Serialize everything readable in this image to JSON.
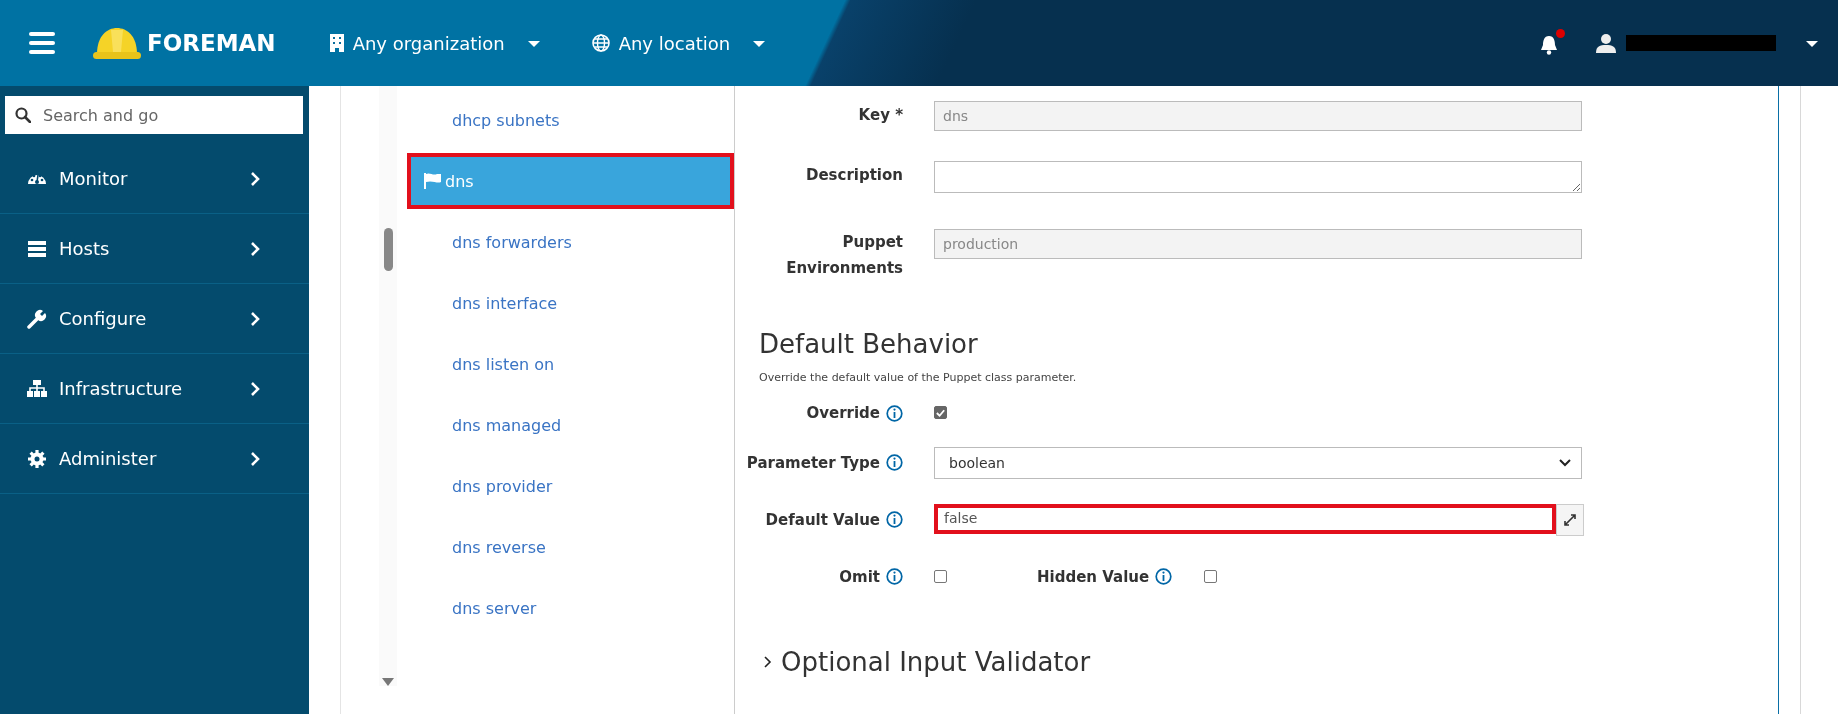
{
  "header": {
    "brand": "FOREMAN",
    "organization": "Any organization",
    "location": "Any location",
    "notifications": {
      "unread": true
    }
  },
  "sidebar": {
    "search": {
      "placeholder": "Search and go"
    },
    "items": [
      {
        "label": "Monitor"
      },
      {
        "label": "Hosts"
      },
      {
        "label": "Configure"
      },
      {
        "label": "Infrastructure"
      },
      {
        "label": "Administer"
      }
    ]
  },
  "parameter_list": {
    "items": [
      {
        "label": "dhcp subnets",
        "selected": false,
        "highlighted": false
      },
      {
        "label": "dns",
        "selected": true,
        "highlighted": true
      },
      {
        "label": "dns forwarders",
        "selected": false,
        "highlighted": false
      },
      {
        "label": "dns interface",
        "selected": false,
        "highlighted": false
      },
      {
        "label": "dns listen on",
        "selected": false,
        "highlighted": false
      },
      {
        "label": "dns managed",
        "selected": false,
        "highlighted": false
      },
      {
        "label": "dns provider",
        "selected": false,
        "highlighted": false
      },
      {
        "label": "dns reverse",
        "selected": false,
        "highlighted": false
      },
      {
        "label": "dns server",
        "selected": false,
        "highlighted": false
      }
    ]
  },
  "form": {
    "fields": [
      {
        "kind": "text",
        "label": "Key *",
        "value": "dns",
        "disabled": true
      },
      {
        "kind": "textarea",
        "label": "Description",
        "disabled": false
      },
      {
        "kind": "text",
        "label": "Puppet Environments",
        "value": "production",
        "disabled": true
      }
    ],
    "default_behavior": {
      "title": "Default Behavior",
      "description": "Override the default value of the Puppet class parameter.",
      "rows": [
        {
          "kind": "checkbox",
          "label": "Override",
          "checked": true
        },
        {
          "kind": "select",
          "label": "Parameter Type",
          "value": "boolean"
        },
        {
          "kind": "expandable",
          "label": "Default Value",
          "value": "false",
          "highlighted": true
        },
        {
          "kind": "checkbox_pair",
          "checkboxes": [
            {
              "label": "Omit",
              "checked": false
            },
            {
              "label": "Hidden Value",
              "checked": false
            }
          ]
        }
      ]
    },
    "validator": {
      "label": "Optional Input Validator",
      "expanded": false
    }
  }
}
